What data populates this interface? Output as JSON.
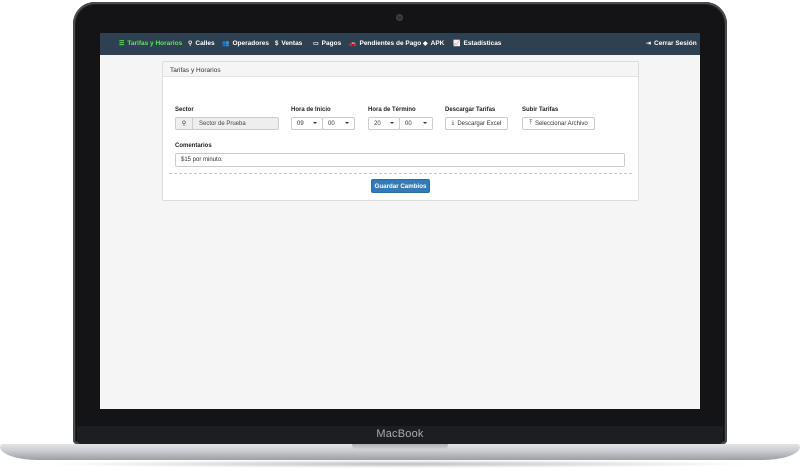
{
  "device": {
    "brand": "MacBook"
  },
  "navbar": {
    "items": [
      {
        "icon": "list-icon",
        "label": "Tarifas y Horarios",
        "active": true
      },
      {
        "icon": "map-marker-icon",
        "label": "Calles"
      },
      {
        "icon": "users-icon",
        "label": "Operadores"
      },
      {
        "icon": "dollar-icon",
        "label": "Ventas"
      },
      {
        "icon": "money-icon",
        "label": "Pagos"
      },
      {
        "icon": "car-icon",
        "label": "Pendientes de Pago"
      },
      {
        "icon": "android-icon",
        "label": "APK"
      },
      {
        "icon": "chart-icon",
        "label": "Estadísticas"
      }
    ],
    "logout": {
      "icon": "sign-out-icon",
      "label": "Cerrar Sesión"
    }
  },
  "panel": {
    "title": "Tarifas y Horarios",
    "sector": {
      "label": "Sector",
      "icon": "map-marker-icon",
      "value": "Sector de Prueba"
    },
    "start": {
      "label": "Hora de Inicio",
      "hour": "09",
      "minute": "00"
    },
    "end": {
      "label": "Hora de Término",
      "hour": "20",
      "minute": "00"
    },
    "download": {
      "label": "Descargar Tarifas",
      "button": "Descargar Excel",
      "icon": "download-icon"
    },
    "upload": {
      "label": "Subir Tarifas",
      "button": "Seleccionar Archivo",
      "icon": "upload-icon"
    },
    "comments": {
      "label": "Comentarios",
      "value": "$15 por minuto."
    },
    "save": "Guardar Cambios"
  },
  "colors": {
    "navbar": "#2f4050",
    "active_nav": "#5ce65c",
    "primary": "#337ab7"
  }
}
